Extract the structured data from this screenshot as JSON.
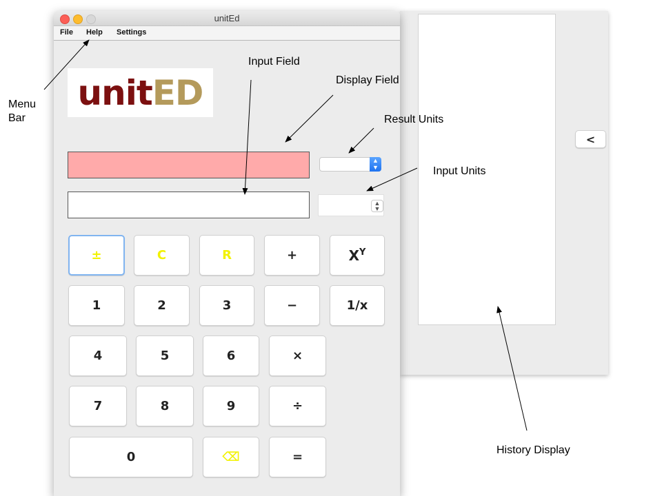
{
  "window": {
    "title": "unitEd"
  },
  "menu": {
    "file": "File",
    "help": "Help",
    "settings": "Settings"
  },
  "logo": {
    "part1": "unit",
    "part2": "ED"
  },
  "history": {
    "collapse_label": "<"
  },
  "keypad": {
    "plus_minus": "±",
    "clear": "C",
    "reset": "R",
    "plus": "+",
    "power_base": "X",
    "power_exp": "Y",
    "one": "1",
    "two": "2",
    "three": "3",
    "minus": "−",
    "reciprocal": "1/x",
    "four": "4",
    "five": "5",
    "six": "6",
    "multiply": "×",
    "seven": "7",
    "eight": "8",
    "nine": "9",
    "divide": "÷",
    "zero": "0",
    "backspace": "⌫",
    "equals": "="
  },
  "annotations": {
    "menu_bar_line1": "Menu",
    "menu_bar_line2": "Bar",
    "input_field": "Input Field",
    "display_field": "Display Field",
    "result_units": "Result Units",
    "input_units": "Input Units",
    "history_display": "History Display"
  },
  "colors": {
    "display_field_bg": "#ffaaaa",
    "yellow_keys": "#f2f200",
    "logo_unit": "#7c1010",
    "logo_ed": "#b49a5b",
    "focus_ring": "#80b4f0"
  }
}
